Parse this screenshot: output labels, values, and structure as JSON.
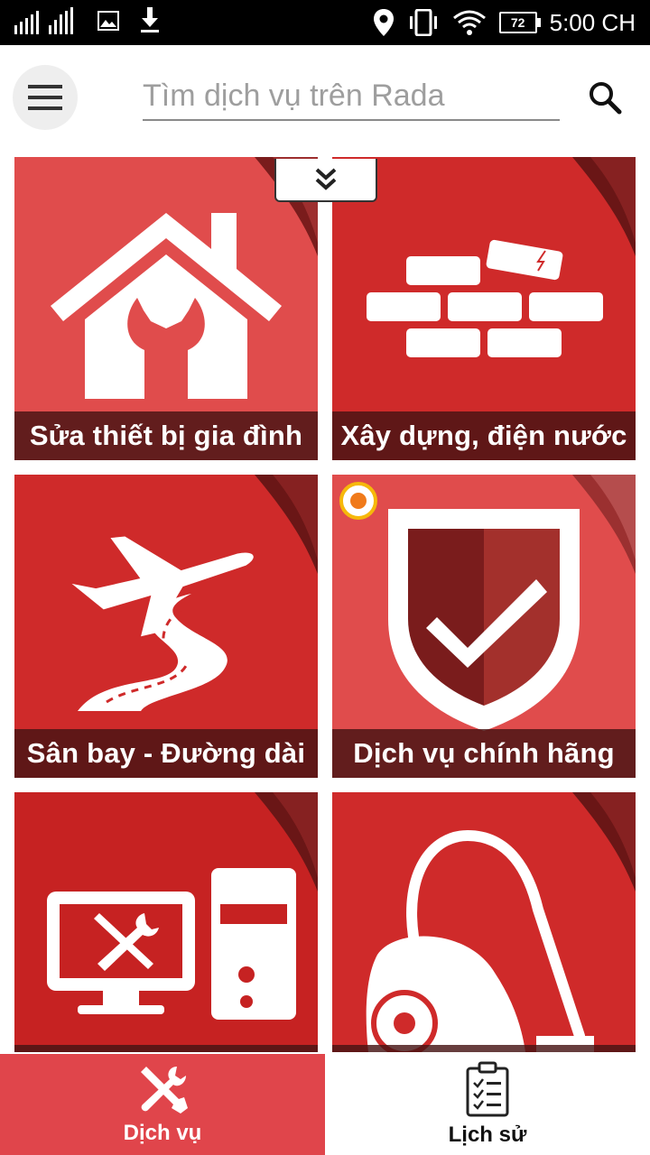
{
  "status_bar": {
    "time": "5:00 CH",
    "battery": "72",
    "icons": [
      "signal-icon",
      "image-icon",
      "download-icon",
      "location-icon",
      "vibrate-icon",
      "wifi-icon",
      "battery-icon"
    ]
  },
  "header": {
    "search_placeholder": "Tìm dịch vụ trên Rada",
    "menu_icon": "hamburger-menu-icon",
    "search_icon": "search-icon",
    "collapse_icon": "double-chevron-down-icon"
  },
  "services": [
    {
      "label": "Sửa thiết bị gia đình",
      "icon": "house-wrench-icon"
    },
    {
      "label": "Xây dựng, điện nước",
      "icon": "bricks-icon"
    },
    {
      "label": "Sân bay - Đường dài",
      "icon": "airplane-road-icon"
    },
    {
      "label": "Dịch vụ chính hãng",
      "icon": "shield-check-icon"
    },
    {
      "label": "",
      "icon": "computer-repair-icon"
    },
    {
      "label": "",
      "icon": "vacuum-cleaner-icon"
    }
  ],
  "bottom_nav": {
    "items": [
      {
        "label": "Dịch vụ",
        "icon": "tools-icon",
        "active": true
      },
      {
        "label": "Lịch sử",
        "icon": "clipboard-list-icon",
        "active": false
      }
    ]
  },
  "colors": {
    "tile_red": "#cf2a2a",
    "tile_light_red": "#e04c4c",
    "fold_dark": "#7a1c1c",
    "nav_active": "#e0454b",
    "badge_ring": "#f6b80a"
  }
}
